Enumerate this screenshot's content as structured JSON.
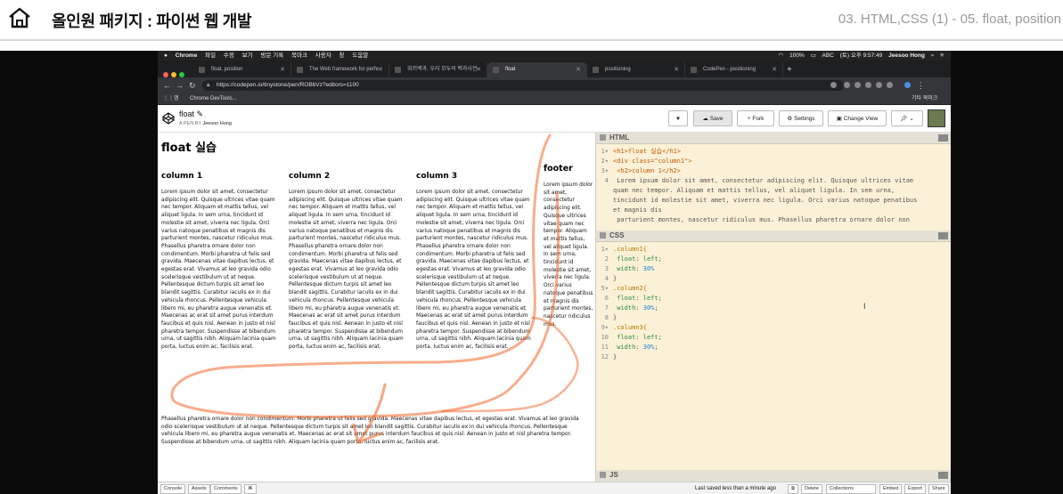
{
  "course": {
    "title": "올인원 패키지 : 파이썬 웹 개발",
    "lesson": "03. HTML,CSS (1) - 05. float, position"
  },
  "menubar": {
    "app": "Chrome",
    "items": [
      "파일",
      "수정",
      "보기",
      "방문 기록",
      "북마크",
      "사용자",
      "창",
      "도움말"
    ],
    "battery": "100%",
    "input": "ABC",
    "clock": "(토) 오후 9:57:49",
    "user": "Jeesoo Hong"
  },
  "tabs": [
    {
      "label": "float, position"
    },
    {
      "label": "The Web framework for perfe"
    },
    {
      "label": "위키백과, 우리 모두의 백과사전"
    },
    {
      "label": "float"
    },
    {
      "label": "positioning"
    },
    {
      "label": "CodePen - positioning"
    }
  ],
  "address": {
    "url": "https://codepen.io/tinystone/pen/ROBbVz?editors=1100"
  },
  "bookmarks": {
    "left": [
      "앱",
      "Chrome DevTools..."
    ],
    "right": "기타 북마크"
  },
  "codepen": {
    "pen_title": "float",
    "author_prefix": "A PEN BY",
    "author": "Jeesoo Hong",
    "buttons": {
      "save": "Save",
      "fork": "Fork",
      "settings": "Settings",
      "change_view": "Change View"
    }
  },
  "preview": {
    "h1": "float 실습",
    "columns": [
      {
        "heading": "column 1"
      },
      {
        "heading": "column 2"
      },
      {
        "heading": "column 3"
      }
    ],
    "footer_heading": "footer",
    "lorem": "Lorem ipsum dolor sit amet, consectetur adipiscing elit. Quisque ultrices vitae quam nec tempor. Aliquam et mattis tellus, vel aliquet ligula. In sem urna, tincidunt id molestie sit amet, viverra nec ligula. Orci varius natoque penatibus et magnis dis parturient montes, nascetur ridiculus mus. Phasellus pharetra ornare dolor non condimentum. Morbi pharetra ut felis sed gravida. Maecenas vitae dapibus lectus, et egestas erat. Vivamus at leo gravida odio scelerisque vestibulum ut at neque. Pellentesque dictum turpis sit amet leo blandit sagittis. Curabitur iaculis ex in dui vehicula rhoncus. Pellentesque vehicula libero mi, eu pharetra augue venenatis et. Maecenas ac erat sit amet purus interdum faucibus et quis nisl. Aenean in justo et nisl pharetra tempor. Suspendisse at bibendum urna, ut sagittis nibh. Aliquam lacinia quam porta, luctus enim ac, facilisis erat.",
    "footer_text": "Lorem ipsum dolor sit amet, consectetur adipiscing elit. Quisque ultrices vitae quam nec tempor. Aliquam et mattis tellus, vel aliquet ligula. In sem urna, tincidunt id molestie sit amet, viverra nec ligula. Orci varius natoque penatibus et magnis dis parturient montes, nascetur ridiculus mus.",
    "after_text": "Phasellus pharetra ornare dolor non condimentum. Morbi pharetra ut felis sed gravida. Maecenas vitae dapibus lectus, et egestas erat. Vivamus at leo gravida odio scelerisque vestibulum ut at neque. Pellentesque dictum turpis sit amet leo blandit sagittis. Curabitur iaculis ex in dui vehicula rhoncus. Pellentesque vehicula libero mi, eu pharetra augue venenatis et. Maecenas ac erat sit amet purus interdum faucibus et quis nisl. Aenean in justo et nisl pharetra tempor. Suspendisse at bibendum urna, ut sagittis nibh. Aliquam lacinia quam porta, luctus enim ac, facilisis erat."
  },
  "editors": {
    "html_label": "HTML",
    "css_label": "CSS",
    "js_label": "JS",
    "html_lines": [
      "<h1>float 실습</h1>",
      "<div class=\"column1\">",
      "  <h2>column 1</h2>",
      "  Lorem ipsum dolor sit amet, consectetur adipiscing elit. Quisque ultrices vitae",
      "quam nec tempor. Aliquam et mattis tellus, vel aliquet ligula. In sem urna,",
      "tincidunt id molestie sit amet, viverra nec ligula. Orci varius natoque penatibus",
      "et magnis dis",
      "  parturient montes, nascetur ridiculus mus. Phasellus pharetra ornare dolor non"
    ],
    "css_lines": [
      {
        "n": "1",
        "text": ".column1{"
      },
      {
        "n": "2",
        "text": "  float: left;"
      },
      {
        "n": "3",
        "text": "  width: 30%"
      },
      {
        "n": "4",
        "text": "}"
      },
      {
        "n": "5",
        "text": ".column2{"
      },
      {
        "n": "6",
        "text": "  float: left;"
      },
      {
        "n": "7",
        "text": "  width: 30%;"
      },
      {
        "n": "8",
        "text": "}"
      },
      {
        "n": "9",
        "text": ".column3{"
      },
      {
        "n": "10",
        "text": "  float: left;"
      },
      {
        "n": "11",
        "text": "  width: 30%;"
      },
      {
        "n": "12",
        "text": "}"
      }
    ]
  },
  "footer_bar": {
    "console": "Console",
    "assets": "Assets",
    "comments": "Comments",
    "saved": "Last saved less than a minute ago",
    "delete": "Delete",
    "collections": "Collections",
    "embed": "Embed",
    "export": "Export",
    "share": "Share"
  },
  "colors": {
    "annotation": "#f26a2e",
    "editor_bg": "#fbf1d8"
  }
}
